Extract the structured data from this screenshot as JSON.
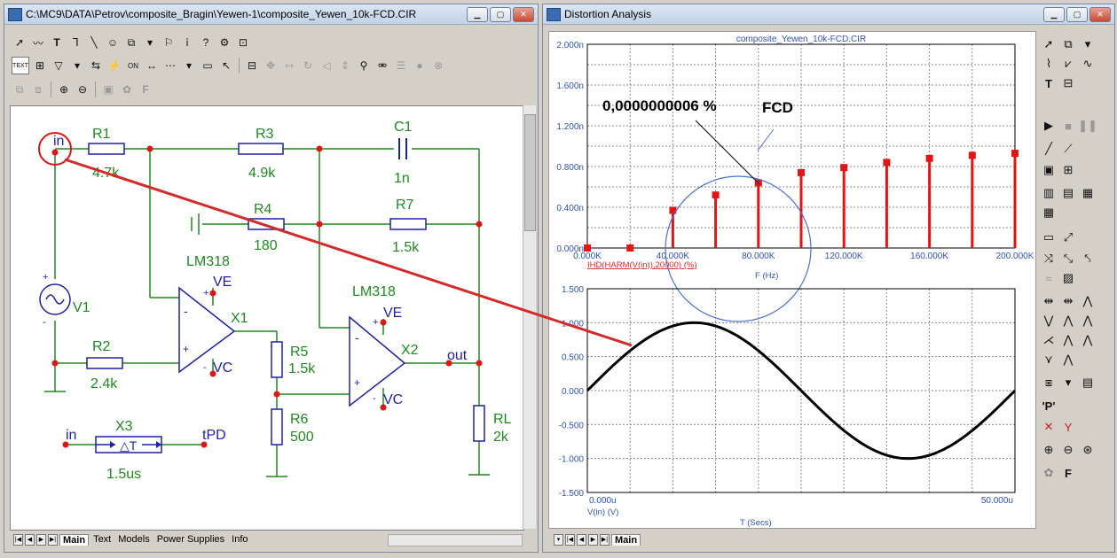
{
  "schematic_window": {
    "title": "C:\\MC9\\DATA\\Petrov\\composite_Bragin\\Yewen-1\\composite_Yewen_10k-FCD.CIR",
    "tabs": [
      "Main",
      "Text",
      "Models",
      "Power Supplies",
      "Info"
    ],
    "active_tab": "Main",
    "toolbar_text_button": "TEXT",
    "components": {
      "r1": {
        "name": "R1",
        "value": "4.7k"
      },
      "r2": {
        "name": "R2",
        "value": "2.4k"
      },
      "r3": {
        "name": "R3",
        "value": "4.9k"
      },
      "r4": {
        "name": "R4",
        "value": "180"
      },
      "r5": {
        "name": "R5",
        "value": "1.5k"
      },
      "r6": {
        "name": "R6",
        "value": "500"
      },
      "r7": {
        "name": "R7",
        "value": "1.5k"
      },
      "rl": {
        "name": "RL",
        "value": "2k"
      },
      "c1": {
        "name": "C1",
        "value": "1n"
      },
      "v1": {
        "name": "V1"
      },
      "x1": {
        "name": "X1",
        "model": "LM318",
        "vplus": "VE",
        "vminus": "VC"
      },
      "x2": {
        "name": "X2",
        "model": "LM318",
        "vplus": "VE",
        "vminus": "VC"
      },
      "x3": {
        "name": "X3",
        "value": "1.5us",
        "in": "in",
        "out": "tPD"
      }
    },
    "node_labels": {
      "in": "in",
      "out": "out"
    }
  },
  "analysis_window": {
    "title": "Distortion Analysis",
    "tab": "Main",
    "colors": {
      "harmonics": "#e31414",
      "waveform": "#000000",
      "annotation": "#4a6fd6",
      "pointer": "#d42a2a"
    },
    "annotation": {
      "value": "0,0000000006 %",
      "label": "FCD"
    }
  },
  "chart_data": [
    {
      "type": "bar",
      "title": "composite_Yewen_10k-FCD.CIR",
      "xlabel": "F (Hz)",
      "ylabel": "IHD(HARM(V(in)),20000) (%)",
      "x_tick_labels": [
        "0.000K",
        "40.000K",
        "80.000K",
        "120.000K",
        "160.000K",
        "200.000K"
      ],
      "y_tick_labels": [
        "0.000n",
        "0.400n",
        "0.800n",
        "1.200n",
        "1.600n",
        "2.000n"
      ],
      "xlim": [
        0,
        200000
      ],
      "ylim": [
        0,
        2.0
      ],
      "y_unit": "n",
      "grid": true,
      "x": [
        0,
        20000,
        40000,
        60000,
        80000,
        100000,
        120000,
        140000,
        160000,
        180000,
        200000
      ],
      "values": [
        0.0,
        0.0,
        0.37,
        0.52,
        0.64,
        0.74,
        0.79,
        0.84,
        0.88,
        0.91,
        0.93
      ]
    },
    {
      "type": "line",
      "xlabel": "T (Secs)",
      "ylabel": "V(in) (V)",
      "x_tick_labels": [
        "0.000u",
        "50.000u"
      ],
      "y_tick_labels": [
        "-1.500",
        "-1.000",
        "-0.500",
        "0.000",
        "0.500",
        "1.000",
        "1.500"
      ],
      "xlim": [
        0,
        50
      ],
      "ylim": [
        -1.5,
        1.5
      ],
      "x_unit": "us",
      "grid": true,
      "series": [
        {
          "function": "sine",
          "amplitude": 1.0,
          "frequency_khz": 20,
          "phase": 0
        }
      ]
    }
  ]
}
